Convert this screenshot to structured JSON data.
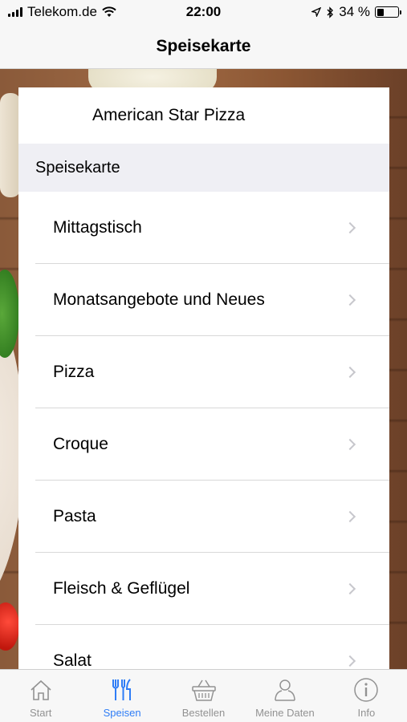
{
  "status_bar": {
    "carrier": "Telekom.de",
    "time": "22:00",
    "battery": "34 %",
    "battery_level": 0.34
  },
  "nav": {
    "title": "Speisekarte"
  },
  "card": {
    "restaurant_name": "American Star Pizza",
    "section_header": "Speisekarte",
    "items": [
      {
        "label": "Mittagstisch"
      },
      {
        "label": "Monatsangebote und Neues"
      },
      {
        "label": "Pizza"
      },
      {
        "label": "Croque"
      },
      {
        "label": "Pasta"
      },
      {
        "label": "Fleisch & Geflügel"
      },
      {
        "label": "Salat"
      }
    ]
  },
  "tabs": [
    {
      "label": "Start",
      "icon": "home-icon",
      "active": false
    },
    {
      "label": "Speisen",
      "icon": "cutlery-icon",
      "active": true
    },
    {
      "label": "Bestellen",
      "icon": "basket-icon",
      "active": false
    },
    {
      "label": "Meine Daten",
      "icon": "person-icon",
      "active": false
    },
    {
      "label": "Info",
      "icon": "info-icon",
      "active": false
    }
  ],
  "colors": {
    "accent": "#2f7df6",
    "inactive_tab": "#929292"
  }
}
